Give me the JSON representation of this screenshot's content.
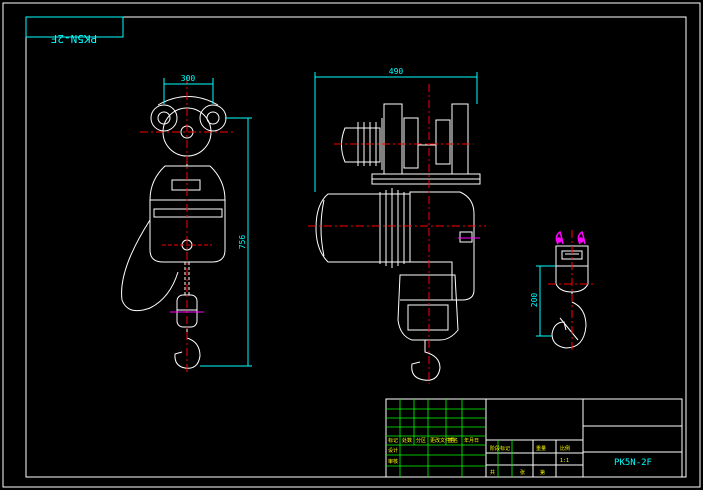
{
  "drawing": {
    "mirrored_code": "PK5N-2F",
    "title_code": "PK5N-2F",
    "colors": {
      "background": "#000000",
      "line": "#ffffff",
      "dimension": "#00ffff",
      "center": "#ff0000",
      "accent": "#ff00ff",
      "grid": "#00ff00"
    }
  },
  "dimensions": {
    "front_width": "300",
    "front_height": "756",
    "side_width": "490",
    "hook_height": "200"
  },
  "title_block": {
    "sheet_scale": "1:1",
    "cell_a": "设计",
    "cell_b": "审核",
    "cell_c": "标记",
    "cell_d": "处数",
    "cell_e": "分区",
    "cell_f": "更改文件号",
    "cell_g": "签名",
    "cell_h": "年月日",
    "cell_i": "阶段标记",
    "cell_j": "重量",
    "cell_k": "比例",
    "cell_l": "共",
    "cell_m": "张",
    "cell_n": "第"
  }
}
